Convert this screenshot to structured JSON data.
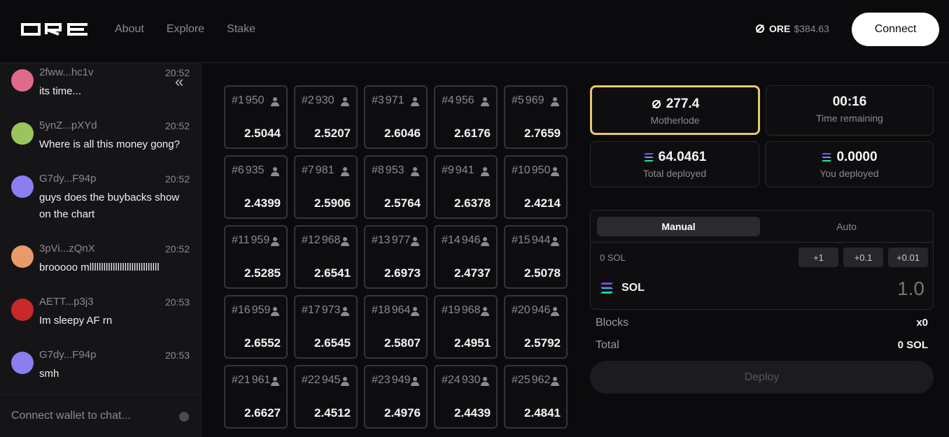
{
  "header": {
    "logo": "ORE",
    "nav": [
      "About",
      "Explore",
      "Stake"
    ],
    "price_token": "ORE",
    "price_value": "$384.63",
    "connect_label": "Connect"
  },
  "chat": {
    "messages": [
      {
        "user": "2fww...hc1v",
        "time": "20:52",
        "text": "its time...",
        "avatar_color": "#e06a8c"
      },
      {
        "user": "5ynZ...pXYd",
        "time": "20:52",
        "text": "Where is all this money gong?",
        "avatar_color": "#9bc45a"
      },
      {
        "user": "G7dy...F94p",
        "time": "20:52",
        "text": "guys does the buybacks show on the chart",
        "avatar_color": "#8a7ef0"
      },
      {
        "user": "3pVi...zQnX",
        "time": "20:52",
        "text": "brooooo mllllllllllllllllllllllllllllll",
        "avatar_color": "#e89a6a"
      },
      {
        "user": "AETT...p3j3",
        "time": "20:53",
        "text": "Im sleepy AF rn",
        "avatar_color": "#c8282a"
      },
      {
        "user": "G7dy...F94p",
        "time": "20:53",
        "text": "smh",
        "avatar_color": "#8a7ef0"
      }
    ],
    "input_placeholder": "Connect wallet to chat..."
  },
  "grid": [
    {
      "id": "#1",
      "count": "950",
      "value": "2.5044"
    },
    {
      "id": "#2",
      "count": "930",
      "value": "2.5207"
    },
    {
      "id": "#3",
      "count": "971",
      "value": "2.6046"
    },
    {
      "id": "#4",
      "count": "956",
      "value": "2.6176"
    },
    {
      "id": "#5",
      "count": "969",
      "value": "2.7659"
    },
    {
      "id": "#6",
      "count": "935",
      "value": "2.4399"
    },
    {
      "id": "#7",
      "count": "981",
      "value": "2.5906"
    },
    {
      "id": "#8",
      "count": "953",
      "value": "2.5764"
    },
    {
      "id": "#9",
      "count": "941",
      "value": "2.6378"
    },
    {
      "id": "#10",
      "count": "950",
      "value": "2.4214"
    },
    {
      "id": "#11",
      "count": "959",
      "value": "2.5285"
    },
    {
      "id": "#12",
      "count": "968",
      "value": "2.6541"
    },
    {
      "id": "#13",
      "count": "977",
      "value": "2.6973"
    },
    {
      "id": "#14",
      "count": "946",
      "value": "2.4737"
    },
    {
      "id": "#15",
      "count": "944",
      "value": "2.5078"
    },
    {
      "id": "#16",
      "count": "959",
      "value": "2.6552"
    },
    {
      "id": "#17",
      "count": "973",
      "value": "2.6545"
    },
    {
      "id": "#18",
      "count": "964",
      "value": "2.5807"
    },
    {
      "id": "#19",
      "count": "968",
      "value": "2.4951"
    },
    {
      "id": "#20",
      "count": "946",
      "value": "2.5792"
    },
    {
      "id": "#21",
      "count": "961",
      "value": "2.6627"
    },
    {
      "id": "#22",
      "count": "945",
      "value": "2.4512"
    },
    {
      "id": "#23",
      "count": "949",
      "value": "2.4976"
    },
    {
      "id": "#24",
      "count": "930",
      "value": "2.4439"
    },
    {
      "id": "#25",
      "count": "962",
      "value": "2.4841"
    }
  ],
  "stats": {
    "motherlode_value": "277.4",
    "motherlode_label": "Motherlode",
    "time_value": "00:16",
    "time_label": "Time remaining",
    "total_value": "64.0461",
    "total_label": "Total deployed",
    "you_value": "0.0000",
    "you_label": "You deployed"
  },
  "form": {
    "tabs": [
      "Manual",
      "Auto"
    ],
    "balance": "0 SOL",
    "increments": [
      "+1",
      "+0.1",
      "+0.01"
    ],
    "token": "SOL",
    "amount": "1.0",
    "blocks_label": "Blocks",
    "blocks_value": "x0",
    "total_label": "Total",
    "total_value": "0 SOL",
    "deploy_label": "Deploy"
  },
  "colors": {
    "accent_gold": "#e8c774",
    "background": "#0b0b0d"
  }
}
